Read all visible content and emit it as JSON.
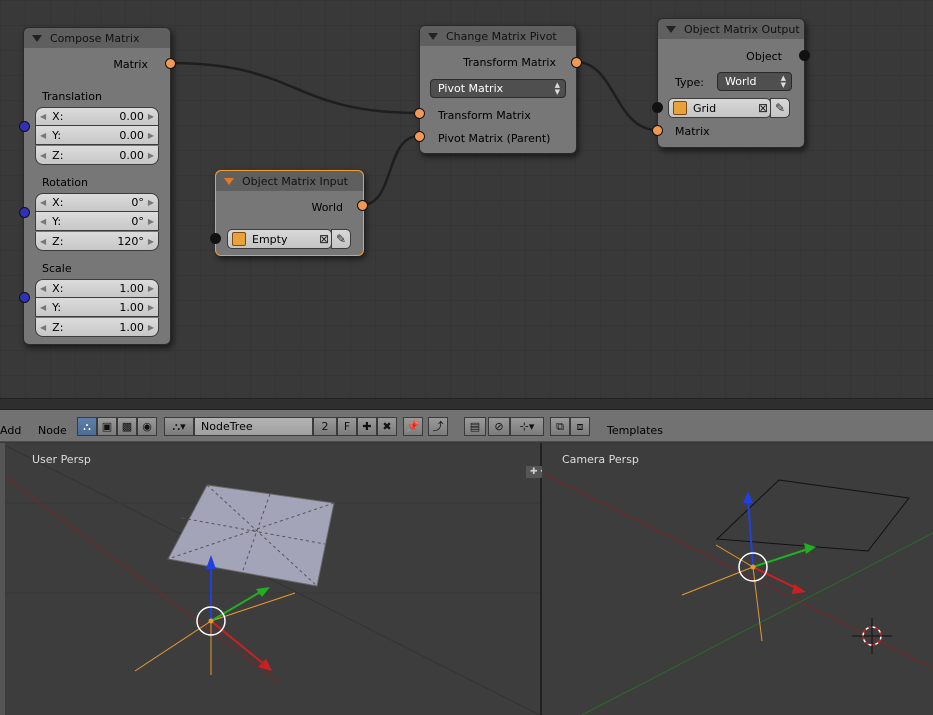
{
  "nodes": {
    "compose_matrix": {
      "title": "Compose Matrix",
      "output_label": "Matrix",
      "translation": {
        "label": "Translation",
        "x_label": "X:",
        "x": "0.00",
        "y_label": "Y:",
        "y": "0.00",
        "z_label": "Z:",
        "z": "0.00"
      },
      "rotation": {
        "label": "Rotation",
        "x_label": "X:",
        "x": "0°",
        "y_label": "Y:",
        "y": "0°",
        "z_label": "Z:",
        "z": "120°"
      },
      "scale": {
        "label": "Scale",
        "x_label": "X:",
        "x": "1.00",
        "y_label": "Y:",
        "y": "1.00",
        "z_label": "Z:",
        "z": "1.00"
      }
    },
    "change_matrix_pivot": {
      "title": "Change Matrix Pivot",
      "output_label": "Transform Matrix",
      "mode_dropdown": "Pivot Matrix",
      "input_transform": "Transform Matrix",
      "input_pivot": "Pivot Matrix (Parent)"
    },
    "object_matrix_input": {
      "title": "Object Matrix Input",
      "output_label": "World",
      "object_name": "Empty"
    },
    "object_matrix_output": {
      "title": "Object Matrix Output",
      "output_label": "Object",
      "type_label": "Type:",
      "type_value": "World",
      "object_name": "Grid",
      "input_label": "Matrix"
    }
  },
  "header": {
    "menu_add": "Add",
    "menu_node": "Node",
    "nodetree_name": "NodeTree",
    "user_count": "2",
    "fake_user": "F",
    "templates": "Templates"
  },
  "viewports": {
    "left_label": "User Persp",
    "right_label": "Camera Persp"
  },
  "colors": {
    "socket_matrix": "#f29855",
    "socket_vector": "#3030b8",
    "link": "#1e1e1e",
    "selected_outline": "#f0a030",
    "axis_x": "#cc2020",
    "axis_y": "#20b020",
    "axis_z": "#2040e0"
  }
}
